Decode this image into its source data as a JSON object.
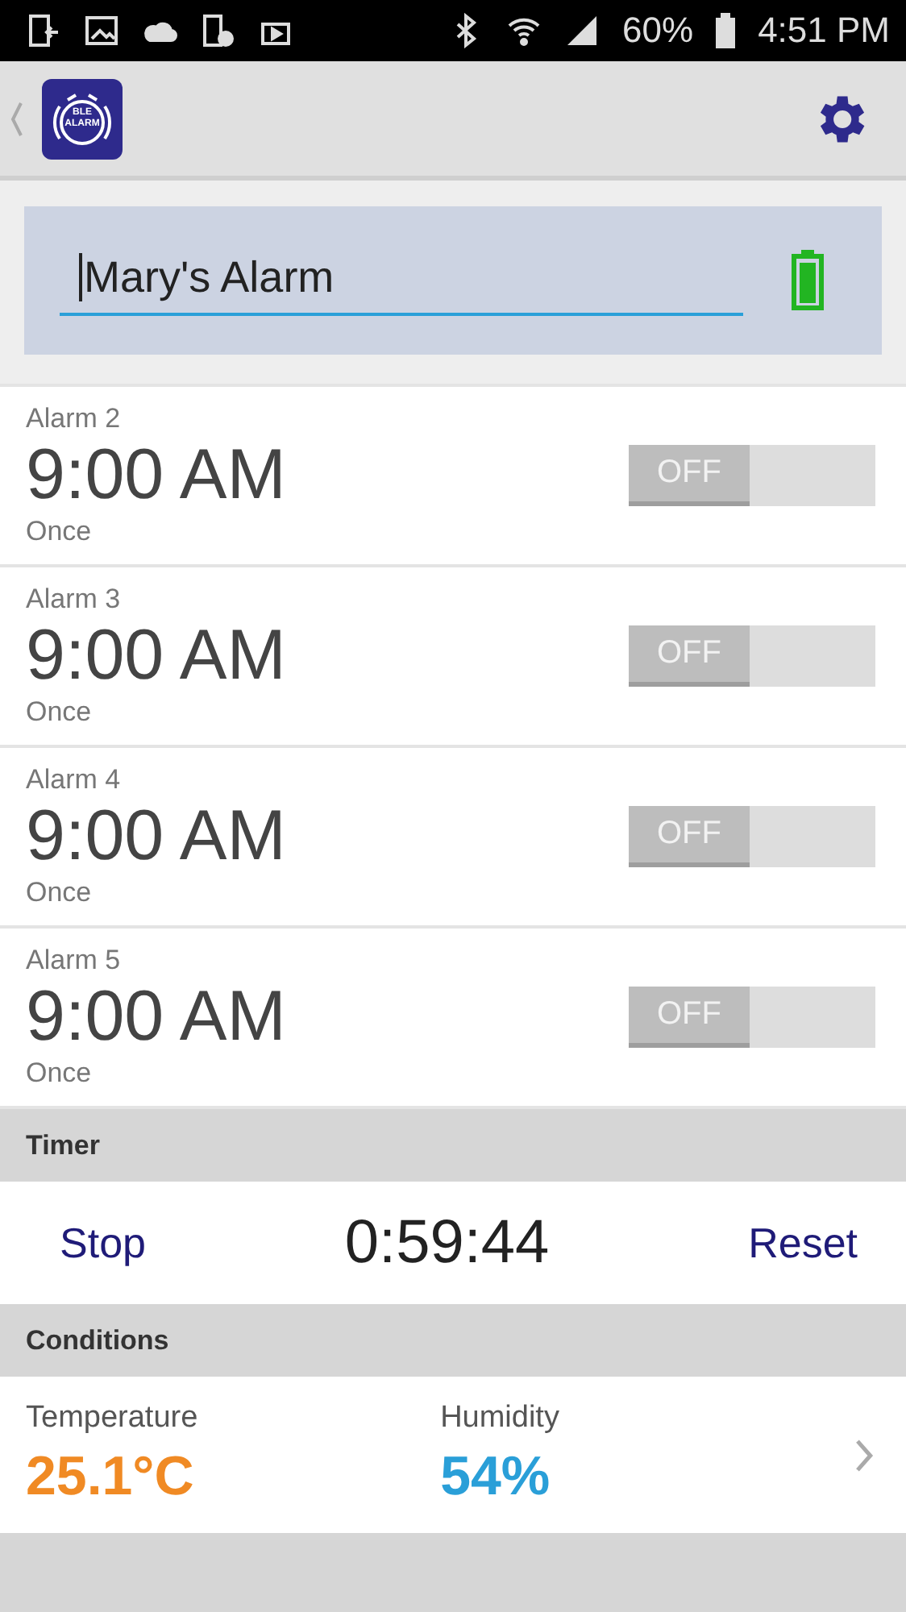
{
  "status_bar": {
    "battery": "60%",
    "time": "4:51 PM"
  },
  "toolbar": {
    "logo_text": "BLE ALARM"
  },
  "device": {
    "name": "Mary's Alarm"
  },
  "alarms": [
    {
      "label": "Alarm 2",
      "time": "9:00 AM",
      "repeat": "Once",
      "on": false,
      "toggle_text": "OFF"
    },
    {
      "label": "Alarm 3",
      "time": "9:00 AM",
      "repeat": "Once",
      "on": false,
      "toggle_text": "OFF"
    },
    {
      "label": "Alarm 4",
      "time": "9:00 AM",
      "repeat": "Once",
      "on": false,
      "toggle_text": "OFF"
    },
    {
      "label": "Alarm 5",
      "time": "9:00 AM",
      "repeat": "Once",
      "on": false,
      "toggle_text": "OFF"
    }
  ],
  "timer": {
    "header": "Timer",
    "stop": "Stop",
    "value": "0:59:44",
    "reset": "Reset"
  },
  "conditions": {
    "header": "Conditions",
    "items": [
      {
        "label": "Temperature",
        "value": "25.1°C",
        "color": "#f08a24"
      },
      {
        "label": "Humidity",
        "value": "54%",
        "color": "#2a9fd8"
      }
    ]
  }
}
